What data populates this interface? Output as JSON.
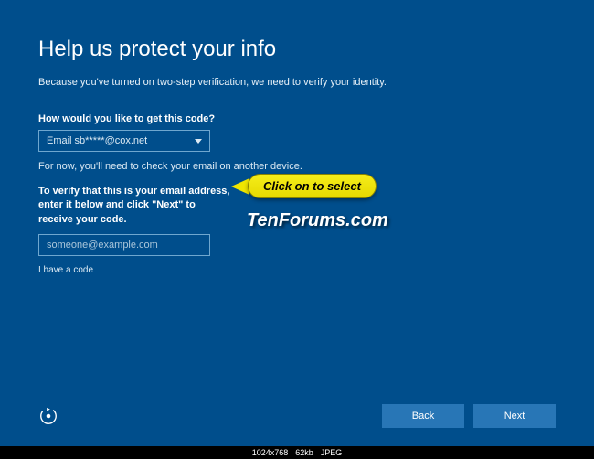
{
  "header": {
    "title": "Help us protect your info",
    "subtitle": "Because you've turned on two-step verification, we need to verify your identity."
  },
  "form": {
    "code_prompt": "How would you like to get this code?",
    "selected_option": "Email sb*****@cox.net",
    "note": "For now, you'll need to check your email on another device.",
    "verify_text": "To verify that this is your email address, enter it below and click \"Next\" to receive your code.",
    "email_placeholder": "someone@example.com",
    "have_code_link": "I have a code"
  },
  "footer": {
    "back_label": "Back",
    "next_label": "Next"
  },
  "annotation": {
    "callout_text": "Click on to select",
    "watermark": "TenForums.com"
  },
  "meta": {
    "dimensions": "1024x768",
    "filesize": "62kb",
    "format": "JPEG"
  }
}
